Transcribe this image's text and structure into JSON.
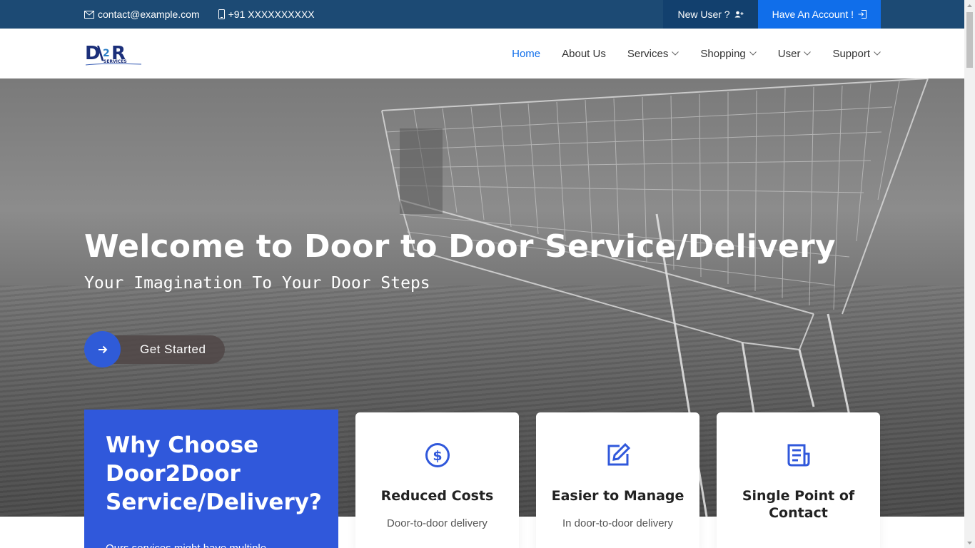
{
  "topbar": {
    "email": "contact@example.com",
    "phone": "+91 XXXXXXXXXX",
    "new_user_label": "New User ?",
    "have_account_label": "Have An Account !"
  },
  "nav": {
    "items": [
      {
        "label": "Home",
        "active": true,
        "dropdown": false
      },
      {
        "label": "About Us",
        "active": false,
        "dropdown": false
      },
      {
        "label": "Services",
        "active": false,
        "dropdown": true
      },
      {
        "label": "Shopping",
        "active": false,
        "dropdown": true
      },
      {
        "label": "User",
        "active": false,
        "dropdown": true
      },
      {
        "label": "Support",
        "active": false,
        "dropdown": true
      }
    ]
  },
  "hero": {
    "title": "Welcome to Door to Door Service/Delivery",
    "tagline": "Your Imagination To Your Door Steps",
    "cta_label": "Get Started"
  },
  "why": {
    "title": "Why Choose Door2Door Service/Delivery?",
    "text": "Ours services might have multiple"
  },
  "features": [
    {
      "icon": "dollar-circle-icon",
      "title": "Reduced Costs",
      "text": "Door-to-door delivery"
    },
    {
      "icon": "edit-icon",
      "title": "Easier to Manage",
      "text": "In door-to-door delivery"
    },
    {
      "icon": "document-icon",
      "title": "Single Point of Contact",
      "text": ""
    }
  ],
  "colors": {
    "topbar": "#1c4a74",
    "accent": "#106eea",
    "why_bg": "#3058db"
  }
}
